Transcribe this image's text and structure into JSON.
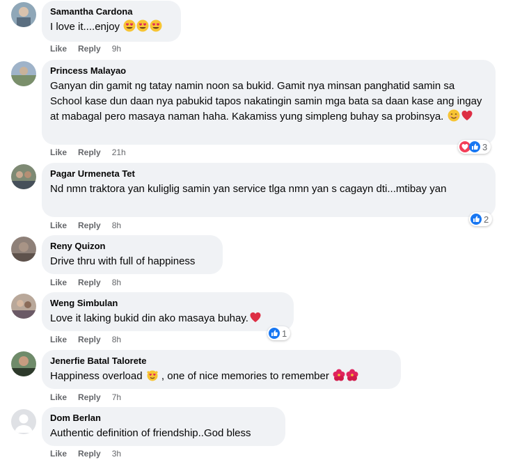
{
  "actions": {
    "like": "Like",
    "reply": "Reply"
  },
  "comments": [
    {
      "name": "Samantha Cardona",
      "text": "I love it....enjoy ",
      "time": "9h",
      "emoji": [
        "heart-eyes-emoji",
        "heart-eyes-emoji",
        "heart-eyes-emoji"
      ]
    },
    {
      "name": "Princess Malayao",
      "text": "Ganyan din gamit ng tatay namin noon sa bukid. Gamit nya minsan panghatid samin sa School kase dun daan nya pabukid tapos nakatingin samin mga bata sa daan kase ang ingay at mabagal pero masaya naman haha. Kakamiss yung simpleng buhay sa probinsya. ",
      "time": "21h",
      "reactions": {
        "count": "3",
        "icons": [
          "heart-reaction-icon",
          "like-reaction-icon"
        ]
      }
    },
    {
      "name": "Pagar Urmeneta Tet",
      "text": "Nd nmn traktora yan kuliglig samin yan service tlga nmn yan s cagayn dti...mtibay yan",
      "time": "8h",
      "reactions": {
        "count": "2",
        "icons": [
          "like-reaction-icon"
        ]
      }
    },
    {
      "name": "Reny Quizon",
      "text": "Drive thru with full of happiness",
      "time": "8h"
    },
    {
      "name": "Weng Simbulan",
      "text": "Love it laking bukid din ako masaya buhay.",
      "time": "8h",
      "reactions": {
        "count": "1",
        "icons": [
          "like-reaction-icon"
        ]
      }
    },
    {
      "name": "Jenerfie Batal Talorete",
      "text": "Happiness overload ",
      "text2": " , one of nice memories to remember ",
      "time": "7h"
    },
    {
      "name": "Dom Berlan",
      "text": "Authentic definition of friendship..God bless",
      "time": "3h"
    }
  ],
  "colors": {
    "bubble": "#f0f2f5",
    "meta": "#65676b",
    "like_blue": "#1877f2",
    "heart_red": "#f33e58"
  }
}
